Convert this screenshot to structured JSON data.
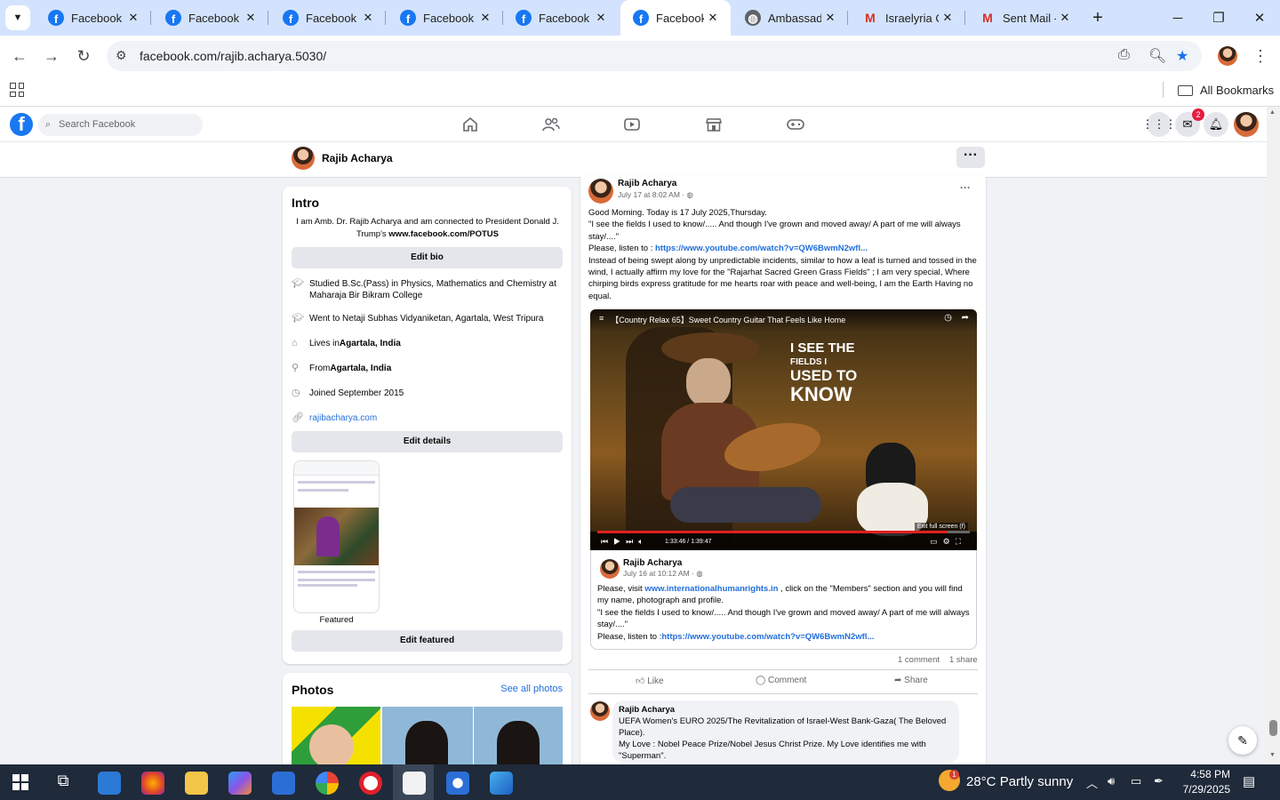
{
  "browser": {
    "tabs": [
      {
        "title": "Facebook",
        "icon": "facebook-icon"
      },
      {
        "title": "Facebook",
        "icon": "facebook-icon"
      },
      {
        "title": "Facebook",
        "icon": "facebook-icon"
      },
      {
        "title": "Facebook",
        "icon": "facebook-icon"
      },
      {
        "title": "Facebook",
        "icon": "facebook-icon"
      },
      {
        "title": "Facebook",
        "icon": "facebook-icon",
        "active": true
      },
      {
        "title": "Ambassado",
        "icon": "globe-icon"
      },
      {
        "title": "Israelyria C",
        "icon": "gmail-icon"
      },
      {
        "title": "Sent Mail -",
        "icon": "gmail-icon"
      }
    ],
    "url": "facebook.com/rajib.acharya.5030/",
    "bookmarks_label": "All Bookmarks"
  },
  "fb": {
    "search_placeholder": "Search Facebook",
    "messenger_badge": "2",
    "profile_name": "Rajib Acharya",
    "intro": {
      "title": "Intro",
      "bio_pre": "I am Amb. Dr. Rajib Acharya and am connected to President Donald J. Trump's ",
      "bio_link": "www.facebook.com/POTUS",
      "edit_bio": "Edit bio",
      "study": "Studied B.Sc.(Pass) in Physics, Mathematics and Chemistry at Maharaja Bir Bikram College",
      "went": "Went to Netaji Subhas Vidyaniketan, Agartala, West Tripura",
      "lives_pre": "Lives in ",
      "lives": "Agartala, India",
      "from_pre": "From ",
      "from": "Agartala, India",
      "joined": "Joined September 2015",
      "website": "rajibacharya.com",
      "edit_details": "Edit details",
      "featured_label": "Featured",
      "edit_featured": "Edit featured"
    },
    "photos": {
      "title": "Photos",
      "see_all": "See all photos"
    },
    "post": {
      "author": "Rajib Acharya",
      "time": "July 17 at 8:02 AM · ",
      "line1": "Good Morning. Today is 17 July 2025,Thursday.",
      "line2": "\"I see the fields I used to know/..... And though I've grown and moved away/ A part of me will always stay/....\"",
      "line3_pre": "Please, listen to : ",
      "line3_link": "https://www.youtube.com/watch?v=QW6BwmN2wfl...",
      "line4": "Instead of being swept along by unpredictable incidents, similar to how a leaf is turned and tossed in the wind, I actually affirm my love for the \"Rajarhat Sacred Green Grass Fields\" ; I am very special, Where chirping birds express gratitude for me hearts roar with peace and well-being,  I am the Earth Having no equal.",
      "video_title": "【Country Relax 65】Sweet Country Guitar That Feels Like Home",
      "video_overlay_1": "I SEE THE",
      "video_overlay_2": "FIELDS I",
      "video_overlay_3": "USED TO",
      "video_overlay_4": "KNOW",
      "video_exit": "Exit full screen (f)",
      "video_time": "1:33:46 / 1:39:47",
      "video_progress": 0.94,
      "shared_author": "Rajib Acharya",
      "shared_time": "July 16 at 10:12 AM · ",
      "shared_pre": "Please, visit ",
      "shared_link": "www.internationalhumanrights.in",
      "shared_post": " , click on the \"Members\" section and you will find my name, photograph and profile.",
      "shared_line2": "\"I see the fields I used to know/..... And though I've grown and moved away/ A part of me will always stay/....\"",
      "shared_line3_pre": "Please, listen to :",
      "shared_line3_link": "https://www.youtube.com/watch?v=QW6BwmN2wfl...",
      "comments": "1 comment",
      "shares": "1 share",
      "like": "Like",
      "comment": "Comment",
      "share": "Share",
      "c_author": "Rajib Acharya",
      "c_line1": "UEFA Women's EURO 2025/The Revitalization of Israel-West Bank-Gaza( The Beloved Place).",
      "c_line2": "My Love : Nobel Peace Prize/Nobel Jesus Christ Prize. My Love identifies me with \"Superman\"."
    }
  },
  "taskbar": {
    "weather_temp": "28°C",
    "weather_desc": "Partly sunny",
    "weather_badge": "1",
    "time": "4:58 PM",
    "date": "7/29/2025"
  },
  "colors": {
    "fb_blue": "#1877f2",
    "link": "#216fdb",
    "tab_strip": "#d3e3fd"
  }
}
